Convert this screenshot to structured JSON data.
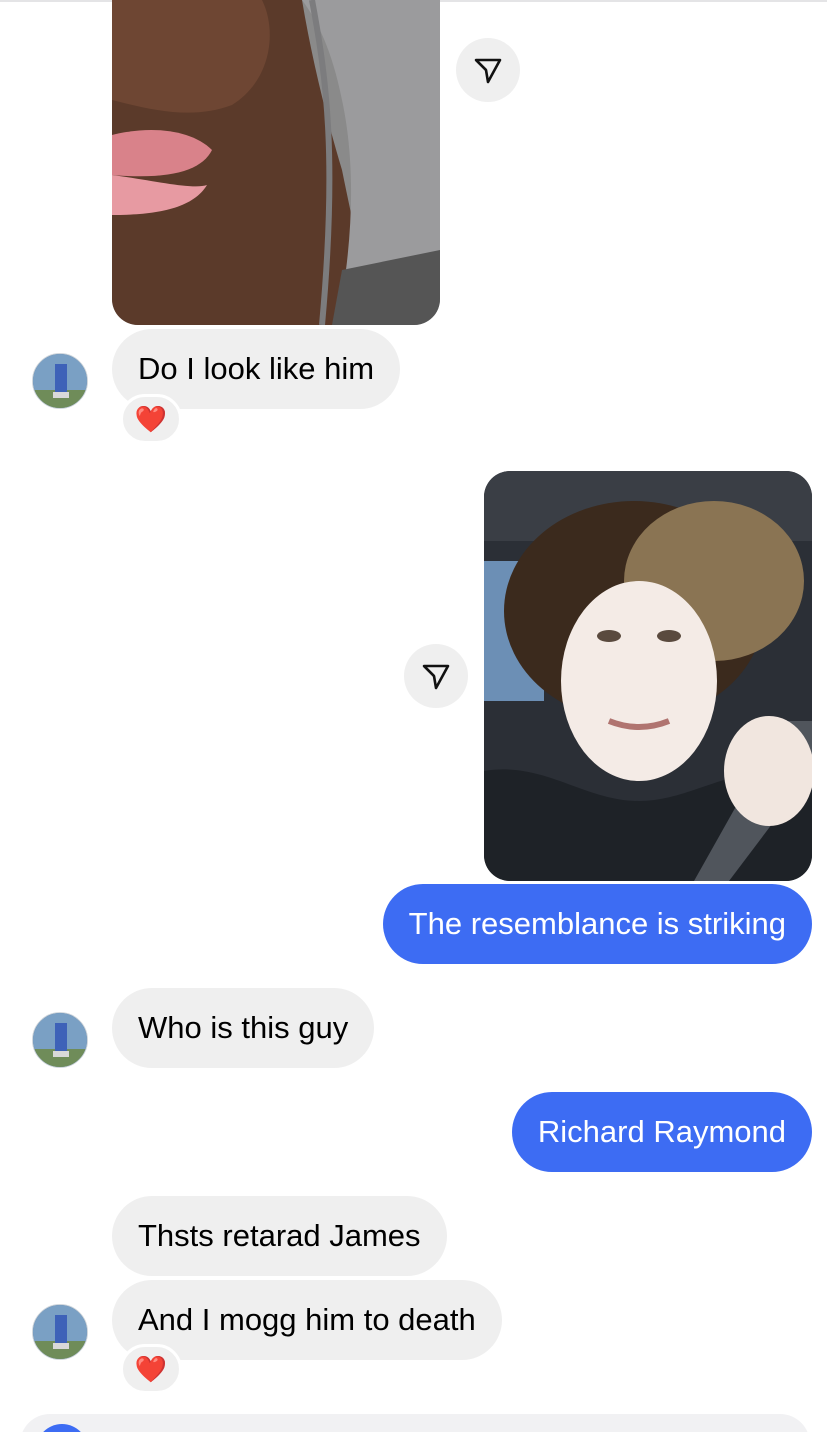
{
  "chat": {
    "messages": [
      {
        "from": "them",
        "type": "image",
        "description_icon": "photo-face-grey-hood"
      },
      {
        "from": "them",
        "type": "text",
        "text": "Do I look like him",
        "reaction": "❤️"
      },
      {
        "from": "me",
        "type": "image",
        "description_icon": "photo-curly-hair-selfie"
      },
      {
        "from": "me",
        "type": "text",
        "text": "The resemblance is striking"
      },
      {
        "from": "them",
        "type": "text",
        "text": "Who is this guy"
      },
      {
        "from": "me",
        "type": "text",
        "text": "Richard Raymond"
      },
      {
        "from": "them",
        "type": "text",
        "text": "Thsts retarad James"
      },
      {
        "from": "them",
        "type": "text",
        "text": "And I mogg him to death",
        "reaction": "❤️"
      }
    ]
  },
  "icons": {
    "share": "paper-plane-icon",
    "reaction": "heart-emoji"
  },
  "colors": {
    "outgoing_bubble": "#3d6cf3",
    "incoming_bubble": "#efefef",
    "background": "#ffffff"
  }
}
